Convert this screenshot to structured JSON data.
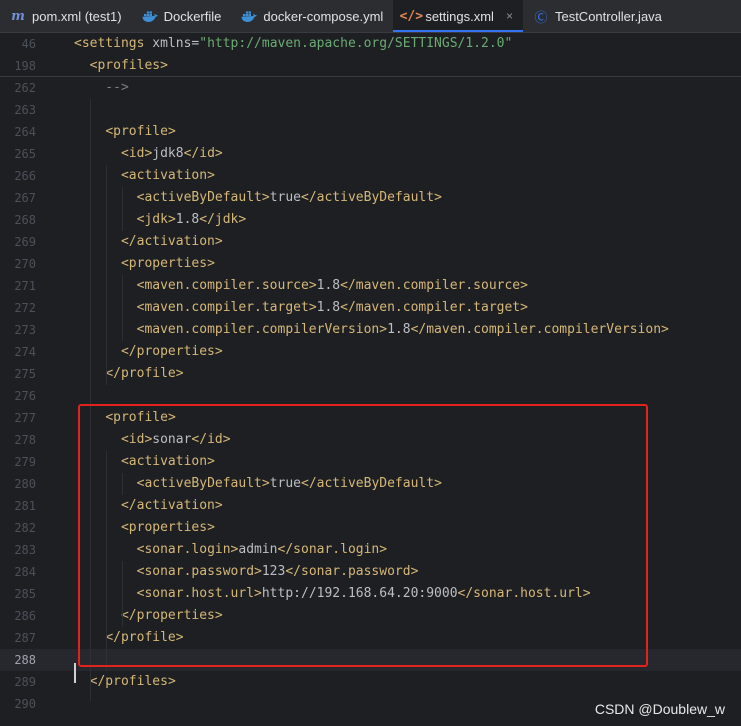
{
  "tabs": [
    {
      "label": "pom.xml (test1)",
      "icon": "maven-icon",
      "active": false
    },
    {
      "label": "Dockerfile",
      "icon": "docker-icon",
      "active": false
    },
    {
      "label": "docker-compose.yml",
      "icon": "docker-icon",
      "active": false
    },
    {
      "label": "settings.xml",
      "icon": "xml-icon",
      "active": true,
      "close": "×"
    },
    {
      "label": "TestController.java",
      "icon": "class-icon",
      "active": false
    }
  ],
  "sticky_lines": [
    {
      "num": "46",
      "text": "<settings xmlns=\"http://maven.apache.org/SETTINGS/1.2.0\""
    },
    {
      "num": "198",
      "text": "  <profiles>"
    }
  ],
  "lines": [
    {
      "num": "262",
      "text": "    -->"
    },
    {
      "num": "263",
      "text": ""
    },
    {
      "num": "264",
      "text": "    <profile>"
    },
    {
      "num": "265",
      "text": "      <id>jdk8</id>"
    },
    {
      "num": "266",
      "text": "      <activation>"
    },
    {
      "num": "267",
      "text": "        <activeByDefault>true</activeByDefault>"
    },
    {
      "num": "268",
      "text": "        <jdk>1.8</jdk>"
    },
    {
      "num": "269",
      "text": "      </activation>"
    },
    {
      "num": "270",
      "text": "      <properties>"
    },
    {
      "num": "271",
      "text": "        <maven.compiler.source>1.8</maven.compiler.source>"
    },
    {
      "num": "272",
      "text": "        <maven.compiler.target>1.8</maven.compiler.target>"
    },
    {
      "num": "273",
      "text": "        <maven.compiler.compilerVersion>1.8</maven.compiler.compilerVersion>"
    },
    {
      "num": "274",
      "text": "      </properties>"
    },
    {
      "num": "275",
      "text": "    </profile>"
    },
    {
      "num": "276",
      "text": ""
    },
    {
      "num": "277",
      "text": "    <profile>"
    },
    {
      "num": "278",
      "text": "      <id>sonar</id>"
    },
    {
      "num": "279",
      "text": "      <activation>"
    },
    {
      "num": "280",
      "text": "        <activeByDefault>true</activeByDefault>"
    },
    {
      "num": "281",
      "text": "      </activation>"
    },
    {
      "num": "282",
      "text": "      <properties>"
    },
    {
      "num": "283",
      "text": "        <sonar.login>admin</sonar.login>"
    },
    {
      "num": "284",
      "text": "        <sonar.password>123</sonar.password>"
    },
    {
      "num": "285",
      "text": "        <sonar.host.url>http://192.168.64.20:9000</sonar.host.url>"
    },
    {
      "num": "286",
      "text": "      </properties>"
    },
    {
      "num": "287",
      "text": "    </profile>"
    },
    {
      "num": "288",
      "text": "",
      "current": true
    },
    {
      "num": "289",
      "text": "  </profiles>"
    },
    {
      "num": "290",
      "text": ""
    }
  ],
  "watermark": "CSDN @Doublew_w",
  "colors": {
    "tag": "#d5b778",
    "string": "#6aab73",
    "text": "#bcbec4",
    "highlight": "#e0231c",
    "accent": "#3574f0"
  }
}
